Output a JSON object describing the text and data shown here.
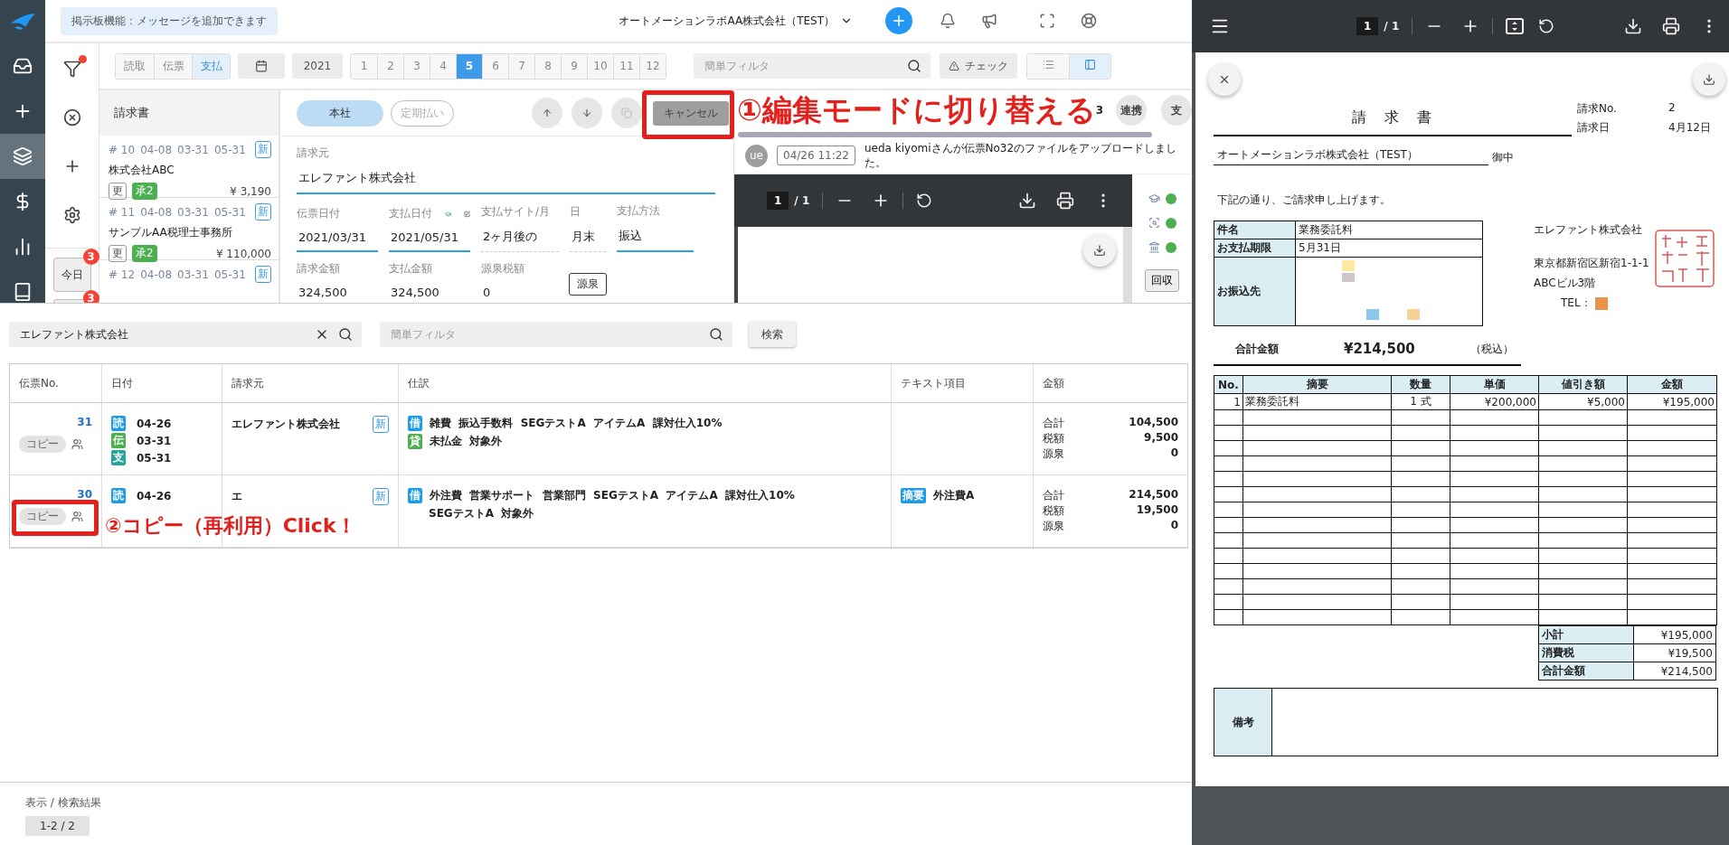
{
  "sidebar": {
    "items": [
      {
        "kind": "inbox",
        "selected": false
      },
      {
        "kind": "plus",
        "selected": false
      },
      {
        "kind": "layers",
        "selected": true
      },
      {
        "kind": "dollar",
        "selected": false
      },
      {
        "kind": "chart",
        "selected": false
      },
      {
        "kind": "book",
        "selected": false
      }
    ]
  },
  "header": {
    "notice": "掲示板機能：メッセージを追加できます",
    "company": "オートメーションラボAA株式会社（TEST）"
  },
  "tool_rail": {
    "filter_active": true,
    "today": {
      "label": "今日",
      "badge": "3"
    },
    "next_badge": "3"
  },
  "toolbar": {
    "modes": [
      {
        "label": "読取",
        "selected": false
      },
      {
        "label": "伝票",
        "selected": false
      },
      {
        "label": "支払",
        "selected": true
      }
    ],
    "year": "2021",
    "months": [
      {
        "label": "1",
        "selected": false
      },
      {
        "label": "2",
        "selected": false
      },
      {
        "label": "3",
        "selected": false
      },
      {
        "label": "4",
        "selected": false
      },
      {
        "label": "5",
        "selected": true
      },
      {
        "label": "6",
        "selected": false
      },
      {
        "label": "7",
        "selected": false
      },
      {
        "label": "8",
        "selected": false
      },
      {
        "label": "9",
        "selected": false
      },
      {
        "label": "10",
        "selected": false
      },
      {
        "label": "11",
        "selected": false
      },
      {
        "label": "12",
        "selected": false
      }
    ],
    "filter_placeholder": "簡単フィルタ",
    "check": "チェック",
    "views": [
      {
        "kind": "list",
        "selected": false
      },
      {
        "kind": "split",
        "selected": true
      }
    ]
  },
  "invoice_list": {
    "title": "請求書",
    "items": [
      {
        "number": "# 10",
        "dates": [
          "04-08",
          "03-31",
          "05-31"
        ],
        "badge": "新",
        "name": "株式会社ABC",
        "tags": [
          {
            "label": "更",
            "kind": "outline"
          },
          {
            "label": "承2",
            "kind": "approved"
          }
        ],
        "amount": "¥ 3,190"
      },
      {
        "number": "# 11",
        "dates": [
          "04-08",
          "03-31",
          "05-31"
        ],
        "badge": "新",
        "name": "サンプルAA税理士事務所",
        "tags": [
          {
            "label": "更",
            "kind": "outline"
          },
          {
            "label": "承2",
            "kind": "approved"
          }
        ],
        "amount": "¥ 110,000"
      },
      {
        "number": "# 12",
        "dates": [
          "04-08",
          "03-31",
          "05-31"
        ],
        "badge": "新"
      }
    ]
  },
  "detail": {
    "branches": [
      {
        "label": "本社",
        "selected": true
      },
      {
        "label": "定期払い",
        "selected": false
      }
    ],
    "cancel": "キャンセル",
    "vendor": {
      "label": "請求元",
      "value": "エレファント株式会社"
    },
    "rows": [
      [
        {
          "label": "伝票日付",
          "value": "2021/03/31",
          "kind": "input"
        },
        {
          "label": "支払日付",
          "value": "2021/05/31",
          "kind": "input"
        },
        {
          "label": "支払サイト/月",
          "value": "2ヶ月後の",
          "kind": "dashed"
        },
        {
          "label": "日",
          "value": "月末",
          "kind": "dashed"
        },
        {
          "label": "支払方法",
          "value": "振込",
          "kind": "input"
        }
      ],
      [
        {
          "label": "請求金額",
          "value": "324,500",
          "kind": "dashed"
        },
        {
          "label": "支払金額",
          "value": "324,500",
          "kind": "dashed"
        },
        {
          "label": "源泉税額",
          "value": "0",
          "kind": "dashed"
        }
      ]
    ],
    "withholding_button": "源泉"
  },
  "side_panel": {
    "count": "3",
    "actions": [
      "連携",
      "支"
    ],
    "activity": {
      "avatar": "ue",
      "time": "04/26 11:22",
      "message": "ueda kiyomiさんが伝票No32のファイルをアップロードしました。"
    },
    "viewer": {
      "page": "1",
      "total": "/ 1"
    },
    "statuses": [
      {
        "kind": "cap",
        "on": true
      },
      {
        "kind": "scan",
        "on": true
      },
      {
        "kind": "bank",
        "on": true
      }
    ],
    "collect": "回収"
  },
  "annotations": [
    "①編集モードに切り替える",
    "②コピー（再利用）Click！"
  ],
  "search_panel": {
    "query": "エレファント株式会社",
    "filter_placeholder": "簡単フィルタ",
    "search_button": "検索",
    "columns": [
      "伝票No.",
      "日付",
      "請求元",
      "仕訳",
      "テキスト項目",
      "金額"
    ],
    "rows": [
      {
        "number": "31",
        "copy": "コピー",
        "dates": [
          {
            "tag": "読",
            "color": "#1e9be9",
            "value": "04-26"
          },
          {
            "tag": "伝",
            "color": "#4caf50",
            "value": "03-31"
          },
          {
            "tag": "支",
            "color": "#26a69a",
            "value": "05-31"
          }
        ],
        "client": "エレファント株式会社",
        "badge": "新",
        "journal": [
          {
            "tag": "借",
            "color": "#1e9be9",
            "text": "雑費  振込手数料  SEGテストA  アイテムA  課対仕入10%"
          },
          {
            "tag": "貸",
            "color": "#4caf50",
            "text": "未払金  対象外"
          }
        ],
        "amounts": [
          {
            "label": "合計",
            "value": "104,500"
          },
          {
            "label": "税額",
            "value": "9,500"
          },
          {
            "label": "源泉",
            "value": "0"
          }
        ]
      },
      {
        "number": "30",
        "copy": "コピー",
        "dates": [
          {
            "tag": "読",
            "color": "#1e9be9",
            "value": "04-26"
          }
        ],
        "client": "エ",
        "badge": "新",
        "journal": [
          {
            "tag": "借",
            "color": "#1e9be9",
            "text": "外注費  営業サポート  営業部門  SEGテストA  アイテムA  課対仕入10%"
          },
          {
            "text": "SEGテストA  対象外"
          }
        ],
        "text_items": [
          {
            "tag": "摘要",
            "text": "外注費A"
          }
        ],
        "amounts": [
          {
            "label": "合計",
            "value": "214,500"
          },
          {
            "label": "税額",
            "value": "19,500"
          },
          {
            "label": "源泉",
            "value": "0"
          }
        ]
      }
    ],
    "footer_label": "表示 / 検索結果",
    "count": "1-2 / 2"
  },
  "pdf": {
    "page": "1",
    "total": "/ 1",
    "document": {
      "title": "請　求　書",
      "meta": [
        {
          "label": "請求No.",
          "value": "2"
        },
        {
          "label": "請求日",
          "value": "4月12日"
        }
      ],
      "addressee": "オートメーションラボ株式会社（TEST）",
      "honorific": "御中",
      "greeting": "下記の通り、ご請求申し上げます。",
      "info": [
        {
          "label": "件名",
          "value": "業務委託料"
        },
        {
          "label": "お支払期限",
          "value": "5月31日"
        },
        {
          "label": "お振込先"
        }
      ],
      "issuer": [
        "エレファント株式会社",
        "東京都新宿区新宿1-1-1",
        "ABCビル3階"
      ],
      "tel": "TEL：",
      "total": {
        "label": "合計金額",
        "value": "¥214,500",
        "note": "（税込）"
      },
      "columns": [
        "No.",
        "摘要",
        "数量",
        "単価",
        "値引き額",
        "金額"
      ],
      "items": [
        [
          "1",
          "業務委託料",
          "1 式",
          "¥200,000",
          "¥5,000",
          "¥195,000"
        ]
      ],
      "summary": [
        {
          "label": "小計",
          "value": "¥195,000"
        },
        {
          "label": "消費税",
          "value": "¥19,500"
        },
        {
          "label": "合計金額",
          "value": "¥214,500"
        }
      ],
      "remarks": "備考"
    }
  }
}
